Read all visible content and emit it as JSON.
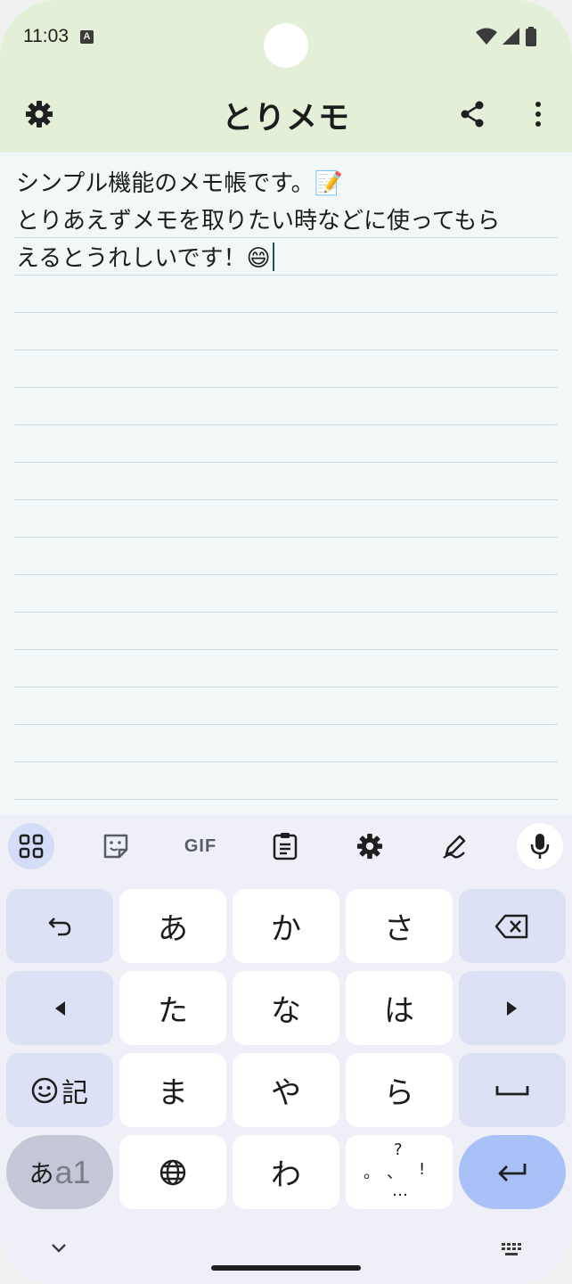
{
  "status_bar": {
    "time": "11:03",
    "notify_letter": "A"
  },
  "app": {
    "title": "とりメモ"
  },
  "note": {
    "lines": [
      "シンプル機能のメモ帳です。📝",
      "とりあえずメモを取りたい時などに使ってもら",
      "えるとうれしいです！😄"
    ]
  },
  "keyboard": {
    "toolbar": {
      "gif_label": "GIF"
    },
    "keys": {
      "a": "あ",
      "ka": "か",
      "sa": "さ",
      "ta": "た",
      "na": "な",
      "ha": "は",
      "ma": "ま",
      "ya": "や",
      "ra": "ら",
      "wa": "わ",
      "emoji_label": "記",
      "mode_hira": "あ",
      "mode_alpha": "a1",
      "punct_question": "?",
      "punct_period": "。",
      "punct_comma": "、",
      "punct_excl": "!",
      "punct_dots": "…"
    }
  },
  "colors": {
    "header_bg": "#e3efd6",
    "note_bg": "#f2f8f8",
    "keyboard_bg": "#eff0f7",
    "func_key": "#dde1f5",
    "enter_key": "#a9c1f7",
    "caret": "#0e5c5c"
  }
}
